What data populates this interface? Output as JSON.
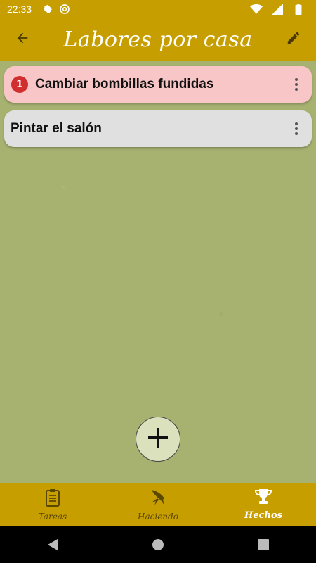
{
  "status_bar": {
    "time": "22:33",
    "left_icons": [
      "settings-icon",
      "at-sign-icon"
    ],
    "right_icons": [
      "wifi-icon",
      "signal-icon",
      "battery-icon"
    ]
  },
  "app_bar": {
    "title": "Labores por casa",
    "back_icon": "arrow-left-icon",
    "edit_icon": "pencil-icon",
    "color": "#c79e00"
  },
  "tasks": [
    {
      "label": "Cambiar bombillas fundidas",
      "priority_badge": "1",
      "priority_color": "#d12f2f",
      "background": "#f8c6c6",
      "menu_icon": "more-vert-icon"
    },
    {
      "label": "Pintar el salón",
      "background": "#e0e0e0",
      "menu_icon": "more-vert-icon"
    }
  ],
  "fab": {
    "icon": "plus-icon"
  },
  "bottom_nav": {
    "tabs": [
      {
        "label": "Tareas",
        "icon": "clipboard-icon",
        "active": false
      },
      {
        "label": "Haciendo",
        "icon": "rocket-icon",
        "active": false
      },
      {
        "label": "Hechos",
        "icon": "trophy-icon",
        "active": true
      }
    ]
  },
  "system_nav": [
    "back-triangle-icon",
    "home-circle-icon",
    "recents-square-icon"
  ],
  "colors": {
    "background": "#a7b271",
    "accent": "#c79e00"
  }
}
